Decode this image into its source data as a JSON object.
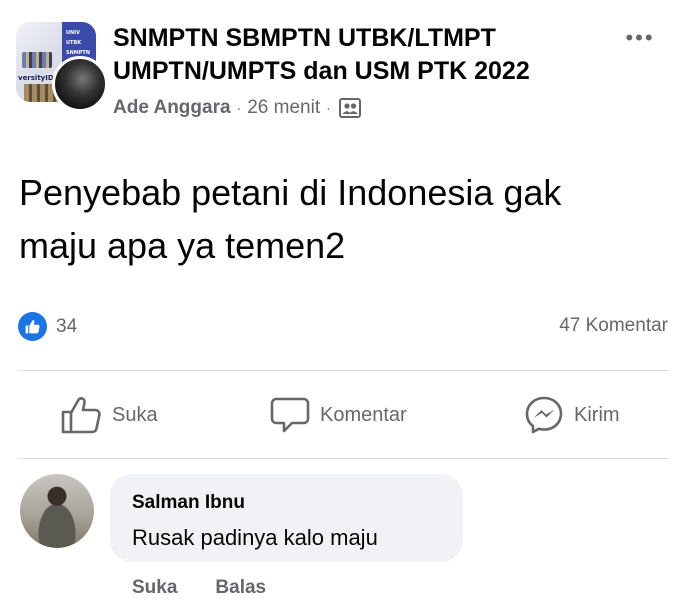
{
  "post": {
    "group_name_line1": "SNMPTN SBMPTN UTBK/LTMPT",
    "group_name_line2": "UMPTN/UMPTS dan USM PTK 2022",
    "author": "Ade Anggara",
    "separator": "·",
    "time": "26 menit",
    "audience_icon": "group-audience-icon",
    "more_label": "•••",
    "text_line1": "Penyebab petani di Indonesia gak",
    "text_line2": "maju apa ya temen2",
    "avatar_logo_text": "versityID",
    "avatar_band_text": [
      "UNIV",
      "UTBK",
      "SNMPTN"
    ]
  },
  "stats": {
    "reaction_icon": "like-icon",
    "reaction_count": "34",
    "comment_count": "47 Komentar"
  },
  "actions": {
    "like_label": "Suka",
    "comment_label": "Komentar",
    "send_label": "Kirim"
  },
  "comment": {
    "name": "Salman Ibnu",
    "text": "Rusak padinya kalo maju",
    "like_label": "Suka",
    "reply_label": "Balas"
  },
  "colors": {
    "accent": "#1b74e4",
    "secondary_text": "#65676b",
    "bubble_bg": "#f0f2f5",
    "divider": "#dadde1"
  }
}
